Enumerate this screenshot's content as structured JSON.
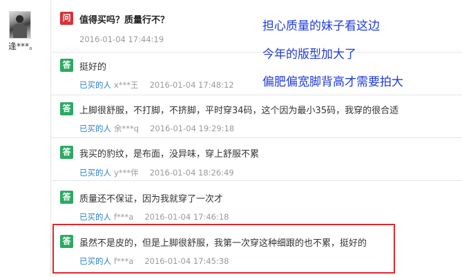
{
  "user": {
    "name": "逢***。"
  },
  "question": {
    "badge": "问",
    "text": "值得买吗？质量行不？",
    "date": "2016-01-04 17:44:19"
  },
  "answer_meta_label": "已买的人",
  "answers": [
    {
      "badge": "答",
      "text": "挺好的",
      "nick": "x***王",
      "date": "2016-01-04 17:48:12"
    },
    {
      "badge": "答",
      "text": "上脚很舒服，不打脚，不挤脚，平时穿34码，这个因为最小35码，我穿的很合适",
      "nick": "余***q",
      "date": "2016-01-04 19:29:18"
    },
    {
      "badge": "答",
      "text": "我买的豹纹，是布面，没异味，穿上舒服不累",
      "nick": "y***伴",
      "date": "2016-01-04 18:26:49"
    },
    {
      "badge": "答",
      "text": "质量还不保证，因为我就穿了一次才",
      "nick": "f***a",
      "date": "2016-01-04 17:46:18"
    },
    {
      "badge": "答",
      "text": "虽然不是皮的，但是上脚很舒服，我第一次穿这种细跟的也不累，挺好的",
      "nick": "f***a",
      "date": "2016-01-04 17:45:38"
    }
  ],
  "annotations": [
    "担心质量的妹子看这边",
    "今年的版型加大了",
    "偏肥偏宽脚背高才需要拍大"
  ],
  "colors": {
    "question_badge": "#d9303a",
    "answer_badge": "#2aaa62",
    "meta_link": "#2a7fd0",
    "annotation": "#1f3bdc",
    "highlight_border": "#e0262b"
  }
}
